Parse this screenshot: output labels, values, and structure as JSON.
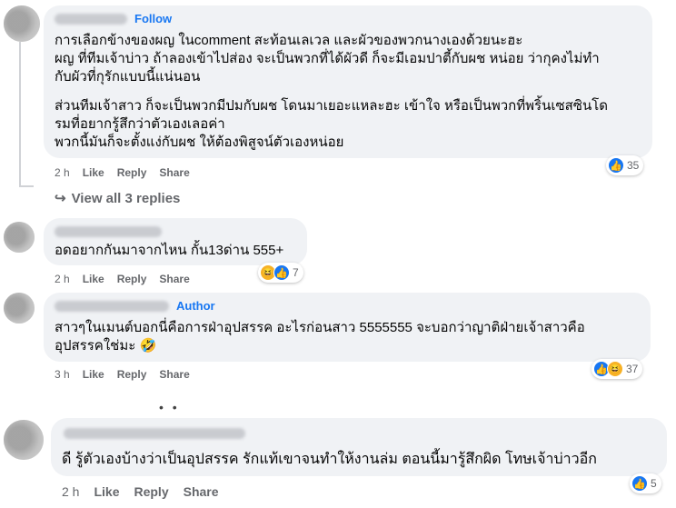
{
  "comments": [
    {
      "badge": "Follow",
      "lines": [
        "การเลือกข้างของผญ ในcomment สะท้อนเลเวล และผัวของพวกนางเองด้วยนะฮะ",
        "ผญ ที่ทีมเจ้าบ่าว ถ้าลองเข้าไปส่อง จะเป็นพวกที่ได้ผัวดี ก็จะมีเอมปาตี้กับผช หน่อย ว่ากุคงไม่ทำ",
        "กับผัวที่กุรักแบบนี้แน่นอน",
        "",
        "ส่วนทีมเจ้าสาว ก็จะเป็นพวกมีปมกับผช โดนมาเยอะแหละฮะ เข้าใจ หรือเป็นพวกที่พริ้นเซสซินโด",
        "รมที่อยากรู้สึกว่าตัวเองเลอค่า",
        "พวกนี้มันก็จะตั้งแง่กับผช ให้ต้องพิสูจน์ตัวเองหน่อย"
      ],
      "time": "2 h",
      "like": "Like",
      "reply": "Reply",
      "share": "Share",
      "reaction_count": "35"
    },
    {
      "badge": "",
      "lines": [
        "อดอยากกันมาจากไหน กั้น13ด่าน 555+"
      ],
      "time": "2 h",
      "like": "Like",
      "reply": "Reply",
      "share": "Share",
      "reaction_count": "7"
    },
    {
      "badge": "Author",
      "lines": [
        "สาวๆในเมนต์บอกนี่คือการฝ่าอุปสรรค อะไรก่อนสาว 5555555 จะบอกว่าญาติฝ่ายเจ้าสาวคือ",
        "อุปสรรคใช่มะ 🤣"
      ],
      "time": "3 h",
      "like": "Like",
      "reply": "Reply",
      "share": "Share",
      "reaction_count": "37"
    },
    {
      "badge": "",
      "lines": [
        "ดี รู้ตัวเองบ้างว่าเป็นอุปสรรค รักแท้เขาจนทำให้งานล่ม ตอนนี้มารู้สึกผิด โทษเจ้าบ่าวอีก"
      ],
      "time": "2 h",
      "like": "Like",
      "reply": "Reply",
      "share": "Share",
      "reaction_count": "5"
    }
  ],
  "view_replies": "View all 3 replies",
  "more_dots": "• •",
  "icons": {
    "like": "like-icon",
    "haha": "haha-icon",
    "reply_arrow": "reply-arrow-icon"
  },
  "colors": {
    "accent": "#1877f2",
    "bubble": "#f0f2f5",
    "meta": "#65676b"
  }
}
